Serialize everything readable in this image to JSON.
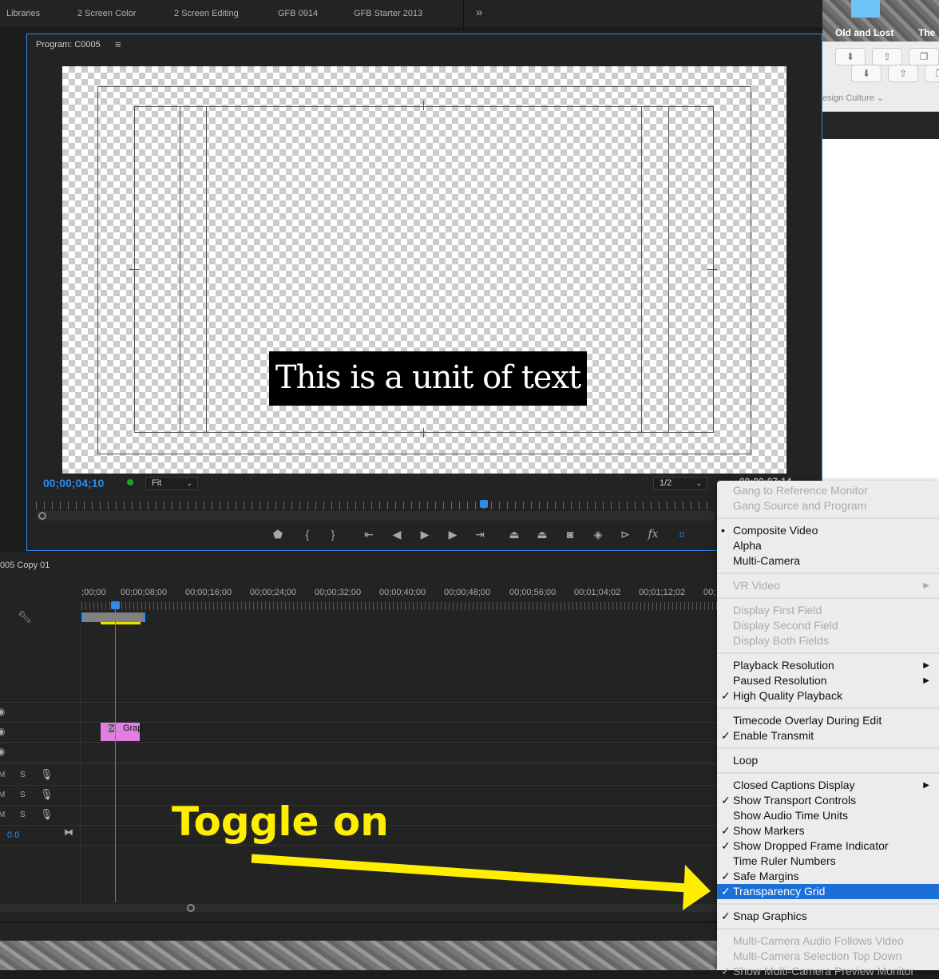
{
  "tabs": [
    "Libraries",
    "2 Screen Color",
    "2 Screen Editing",
    "GFB 0914",
    "GFB Starter 2013"
  ],
  "overflow_icon": "»",
  "desktop": {
    "folder_label": "Old and Lost",
    "folder_label_2": "The",
    "browser_link": "esign Culture ⌄"
  },
  "program": {
    "title": "Program: C0005",
    "menu_icon": "≡",
    "overlay_text": "This is a unit of text",
    "timecode": "00;00;04;10",
    "zoom_select": "Fit",
    "resolution_select": "1/2",
    "duration_partial": "00;00;07;14"
  },
  "transport_icons": [
    "marker-icon",
    "mark-in-icon",
    "mark-out-icon",
    "go-to-in-icon",
    "step-back-icon",
    "play-icon",
    "step-forward-icon",
    "go-to-out-icon",
    "lift-icon",
    "extract-icon",
    "export-frame-icon",
    "comparison-view-icon",
    "trim-icon",
    "fx-icon",
    "safe-margins-icon"
  ],
  "timeline": {
    "sequence_name": "005 Copy 01",
    "ruler": [
      ";00;00",
      "00;00;08;00",
      "00;00;16;00",
      "00;00;24;00",
      "00;00;32;00",
      "00;00;40;00",
      "00;00;48;00",
      "00;00;56;00",
      "00;01;04;02",
      "00;01;12;02",
      "00;"
    ],
    "clip_label": "Grap",
    "audio_tracks": [
      {
        "m": "M",
        "s": "S"
      },
      {
        "m": "M",
        "s": "S"
      },
      {
        "m": "M",
        "s": "S"
      }
    ],
    "master_volume": "0.0"
  },
  "menu": {
    "sections": [
      [
        {
          "label": "Gang to Reference Monitor",
          "disabled": true
        },
        {
          "label": "Gang Source and Program",
          "disabled": true
        }
      ],
      [
        {
          "label": "Composite Video",
          "mark": "•"
        },
        {
          "label": "Alpha"
        },
        {
          "label": "Multi-Camera"
        }
      ],
      [
        {
          "label": "VR Video",
          "disabled": true,
          "submenu": true
        }
      ],
      [
        {
          "label": "Display First Field",
          "disabled": true
        },
        {
          "label": "Display Second Field",
          "disabled": true
        },
        {
          "label": "Display Both Fields",
          "disabled": true
        }
      ],
      [
        {
          "label": "Playback Resolution",
          "submenu": true
        },
        {
          "label": "Paused Resolution",
          "submenu": true
        },
        {
          "label": "High Quality Playback",
          "mark": "✓"
        }
      ],
      [
        {
          "label": "Timecode Overlay During Edit"
        },
        {
          "label": "Enable Transmit",
          "mark": "✓"
        }
      ],
      [
        {
          "label": "Loop"
        }
      ],
      [
        {
          "label": "Closed Captions Display",
          "submenu": true
        },
        {
          "label": "Show Transport Controls",
          "mark": "✓"
        },
        {
          "label": "Show Audio Time Units"
        },
        {
          "label": "Show Markers",
          "mark": "✓"
        },
        {
          "label": "Show Dropped Frame Indicator",
          "mark": "✓"
        },
        {
          "label": "Time Ruler Numbers"
        },
        {
          "label": "Safe Margins",
          "mark": "✓"
        },
        {
          "label": "Transparency Grid",
          "mark": "✓",
          "highlighted": true
        }
      ],
      [
        {
          "label": "Snap Graphics",
          "mark": "✓"
        }
      ],
      [
        {
          "label": "Multi-Camera Audio Follows Video",
          "disabled": true
        },
        {
          "label": "Multi-Camera Selection Top Down",
          "disabled": true
        },
        {
          "label": "Show Multi-Camera Preview Monitor",
          "mark": "✓",
          "disabled": true
        }
      ]
    ]
  },
  "annotation": {
    "text": "Toggle on",
    "color": "#ffee00"
  },
  "colors": {
    "accent": "#2d8ceb",
    "highlight": "#1a6fd8",
    "clip": "#e07fe0"
  }
}
